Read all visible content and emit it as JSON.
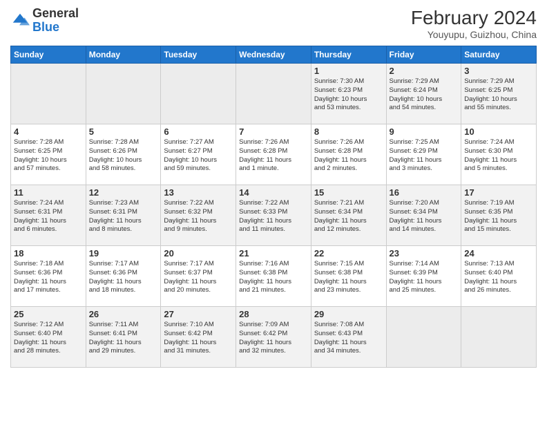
{
  "header": {
    "logo": {
      "general": "General",
      "blue": "Blue"
    },
    "title": "February 2024",
    "location": "Youyupu, Guizhou, China"
  },
  "days_of_week": [
    "Sunday",
    "Monday",
    "Tuesday",
    "Wednesday",
    "Thursday",
    "Friday",
    "Saturday"
  ],
  "weeks": [
    [
      {
        "day": "",
        "info": ""
      },
      {
        "day": "",
        "info": ""
      },
      {
        "day": "",
        "info": ""
      },
      {
        "day": "",
        "info": ""
      },
      {
        "day": "1",
        "info": "Sunrise: 7:30 AM\nSunset: 6:23 PM\nDaylight: 10 hours\nand 53 minutes."
      },
      {
        "day": "2",
        "info": "Sunrise: 7:29 AM\nSunset: 6:24 PM\nDaylight: 10 hours\nand 54 minutes."
      },
      {
        "day": "3",
        "info": "Sunrise: 7:29 AM\nSunset: 6:25 PM\nDaylight: 10 hours\nand 55 minutes."
      }
    ],
    [
      {
        "day": "4",
        "info": "Sunrise: 7:28 AM\nSunset: 6:25 PM\nDaylight: 10 hours\nand 57 minutes."
      },
      {
        "day": "5",
        "info": "Sunrise: 7:28 AM\nSunset: 6:26 PM\nDaylight: 10 hours\nand 58 minutes."
      },
      {
        "day": "6",
        "info": "Sunrise: 7:27 AM\nSunset: 6:27 PM\nDaylight: 10 hours\nand 59 minutes."
      },
      {
        "day": "7",
        "info": "Sunrise: 7:26 AM\nSunset: 6:28 PM\nDaylight: 11 hours\nand 1 minute."
      },
      {
        "day": "8",
        "info": "Sunrise: 7:26 AM\nSunset: 6:28 PM\nDaylight: 11 hours\nand 2 minutes."
      },
      {
        "day": "9",
        "info": "Sunrise: 7:25 AM\nSunset: 6:29 PM\nDaylight: 11 hours\nand 3 minutes."
      },
      {
        "day": "10",
        "info": "Sunrise: 7:24 AM\nSunset: 6:30 PM\nDaylight: 11 hours\nand 5 minutes."
      }
    ],
    [
      {
        "day": "11",
        "info": "Sunrise: 7:24 AM\nSunset: 6:31 PM\nDaylight: 11 hours\nand 6 minutes."
      },
      {
        "day": "12",
        "info": "Sunrise: 7:23 AM\nSunset: 6:31 PM\nDaylight: 11 hours\nand 8 minutes."
      },
      {
        "day": "13",
        "info": "Sunrise: 7:22 AM\nSunset: 6:32 PM\nDaylight: 11 hours\nand 9 minutes."
      },
      {
        "day": "14",
        "info": "Sunrise: 7:22 AM\nSunset: 6:33 PM\nDaylight: 11 hours\nand 11 minutes."
      },
      {
        "day": "15",
        "info": "Sunrise: 7:21 AM\nSunset: 6:34 PM\nDaylight: 11 hours\nand 12 minutes."
      },
      {
        "day": "16",
        "info": "Sunrise: 7:20 AM\nSunset: 6:34 PM\nDaylight: 11 hours\nand 14 minutes."
      },
      {
        "day": "17",
        "info": "Sunrise: 7:19 AM\nSunset: 6:35 PM\nDaylight: 11 hours\nand 15 minutes."
      }
    ],
    [
      {
        "day": "18",
        "info": "Sunrise: 7:18 AM\nSunset: 6:36 PM\nDaylight: 11 hours\nand 17 minutes."
      },
      {
        "day": "19",
        "info": "Sunrise: 7:17 AM\nSunset: 6:36 PM\nDaylight: 11 hours\nand 18 minutes."
      },
      {
        "day": "20",
        "info": "Sunrise: 7:17 AM\nSunset: 6:37 PM\nDaylight: 11 hours\nand 20 minutes."
      },
      {
        "day": "21",
        "info": "Sunrise: 7:16 AM\nSunset: 6:38 PM\nDaylight: 11 hours\nand 21 minutes."
      },
      {
        "day": "22",
        "info": "Sunrise: 7:15 AM\nSunset: 6:38 PM\nDaylight: 11 hours\nand 23 minutes."
      },
      {
        "day": "23",
        "info": "Sunrise: 7:14 AM\nSunset: 6:39 PM\nDaylight: 11 hours\nand 25 minutes."
      },
      {
        "day": "24",
        "info": "Sunrise: 7:13 AM\nSunset: 6:40 PM\nDaylight: 11 hours\nand 26 minutes."
      }
    ],
    [
      {
        "day": "25",
        "info": "Sunrise: 7:12 AM\nSunset: 6:40 PM\nDaylight: 11 hours\nand 28 minutes."
      },
      {
        "day": "26",
        "info": "Sunrise: 7:11 AM\nSunset: 6:41 PM\nDaylight: 11 hours\nand 29 minutes."
      },
      {
        "day": "27",
        "info": "Sunrise: 7:10 AM\nSunset: 6:42 PM\nDaylight: 11 hours\nand 31 minutes."
      },
      {
        "day": "28",
        "info": "Sunrise: 7:09 AM\nSunset: 6:42 PM\nDaylight: 11 hours\nand 32 minutes."
      },
      {
        "day": "29",
        "info": "Sunrise: 7:08 AM\nSunset: 6:43 PM\nDaylight: 11 hours\nand 34 minutes."
      },
      {
        "day": "",
        "info": ""
      },
      {
        "day": "",
        "info": ""
      }
    ]
  ]
}
